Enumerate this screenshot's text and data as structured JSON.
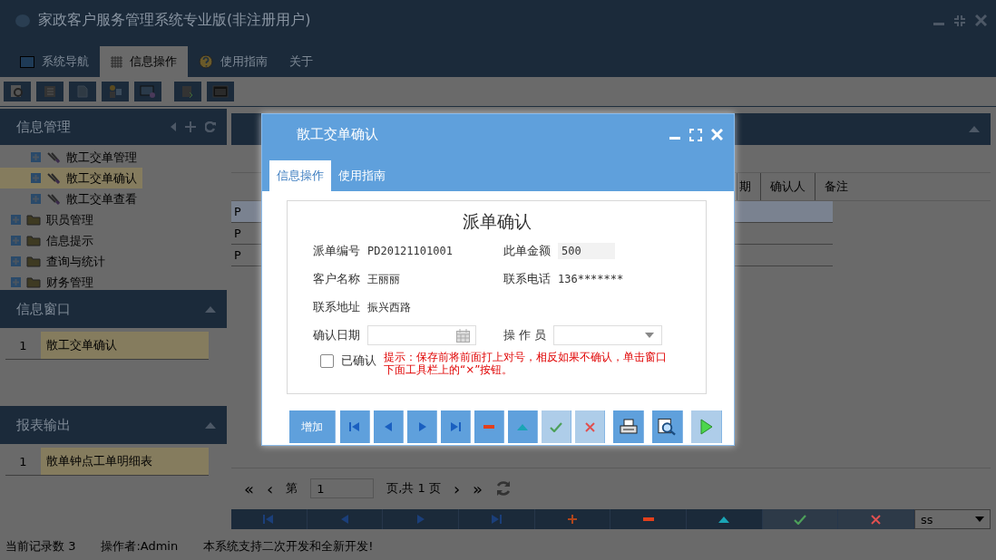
{
  "window": {
    "title": "家政客户服务管理系统专业版(非注册用户)"
  },
  "main_tabs": [
    {
      "label": "系统导航",
      "selected": false
    },
    {
      "label": "信息操作",
      "selected": true
    },
    {
      "label": "使用指南",
      "selected": false
    },
    {
      "label": "关于",
      "selected": false
    }
  ],
  "left_panel": {
    "title": "信息管理",
    "tree": [
      {
        "label": "散工交单管理",
        "kind": "leaf",
        "selected": false
      },
      {
        "label": "散工交单确认",
        "kind": "leaf",
        "selected": true
      },
      {
        "label": "散工交单查看",
        "kind": "leaf",
        "selected": false
      },
      {
        "label": "职员管理",
        "kind": "folder",
        "selected": false
      },
      {
        "label": "信息提示",
        "kind": "folder",
        "selected": false
      },
      {
        "label": "查询与统计",
        "kind": "folder",
        "selected": false
      },
      {
        "label": "财务管理",
        "kind": "folder",
        "selected": false
      }
    ]
  },
  "info_window": {
    "title": "信息窗口",
    "rows": [
      {
        "index": "1",
        "label": "散工交单确认"
      }
    ]
  },
  "report_output": {
    "title": "报表输出",
    "rows": [
      {
        "index": "1",
        "label": "散单钟点工单明细表"
      }
    ]
  },
  "grid": {
    "columns": [
      "期",
      "确认人",
      "备注"
    ],
    "rows": [
      {
        "cell": "P",
        "selected": true
      },
      {
        "cell": "P",
        "selected": false
      },
      {
        "cell": "P",
        "selected": false
      }
    ]
  },
  "pager": {
    "first": "«",
    "prev": "‹",
    "prefix": "第",
    "page": "1",
    "suffix": "页,共 1 页",
    "next": "›",
    "last": "»"
  },
  "bottom_nav": [
    {
      "kind": "first",
      "disabled": false
    },
    {
      "kind": "prev",
      "disabled": false
    },
    {
      "kind": "next",
      "disabled": false
    },
    {
      "kind": "last",
      "disabled": false
    },
    {
      "kind": "add",
      "disabled": false
    },
    {
      "kind": "remove",
      "disabled": false
    },
    {
      "kind": "up",
      "disabled": false
    },
    {
      "kind": "confirm",
      "disabled": true
    },
    {
      "kind": "cancel",
      "disabled": true
    }
  ],
  "page_size_select": {
    "value": "ss"
  },
  "status_bar": [
    "当前记录数 3",
    "操作者:Admin",
    "本系统支持二次开发和全新开发!"
  ],
  "dialog": {
    "title": "散工交单确认",
    "tabs": [
      {
        "label": "信息操作",
        "selected": true
      },
      {
        "label": "使用指南",
        "selected": false
      }
    ],
    "form": {
      "heading": "派单确认",
      "fields": [
        {
          "label": "派单编号",
          "value": "PD20121101001",
          "kind": "plain"
        },
        {
          "label": "此单金额",
          "value": "500",
          "kind": "boxed"
        },
        {
          "label": "客户名称",
          "value": "王丽丽",
          "kind": "plain"
        },
        {
          "label": "联系电话",
          "value": "136*******",
          "kind": "plain"
        },
        {
          "label": "联系地址",
          "value": "振兴西路",
          "kind": "plain"
        }
      ],
      "date_label": "确认日期",
      "operator_label": "操 作 员",
      "confirmed": {
        "label": "已确认",
        "checked": false
      },
      "hint": "提示：保存前将前面打上对号，相反如果不确认，单击窗口下面工具栏上的“×”按钮。"
    },
    "toolbar": [
      {
        "kind": "add",
        "label": "增加",
        "disabled": false
      },
      {
        "kind": "first",
        "disabled": false
      },
      {
        "kind": "prev",
        "disabled": false
      },
      {
        "kind": "next",
        "disabled": false
      },
      {
        "kind": "last",
        "disabled": false
      },
      {
        "kind": "remove",
        "disabled": false
      },
      {
        "kind": "up",
        "disabled": false
      },
      {
        "kind": "confirm",
        "disabled": true
      },
      {
        "kind": "cancel",
        "disabled": true
      },
      {
        "kind": "print",
        "disabled": false
      },
      {
        "kind": "preview",
        "disabled": false
      },
      {
        "kind": "run",
        "disabled": true
      }
    ]
  }
}
